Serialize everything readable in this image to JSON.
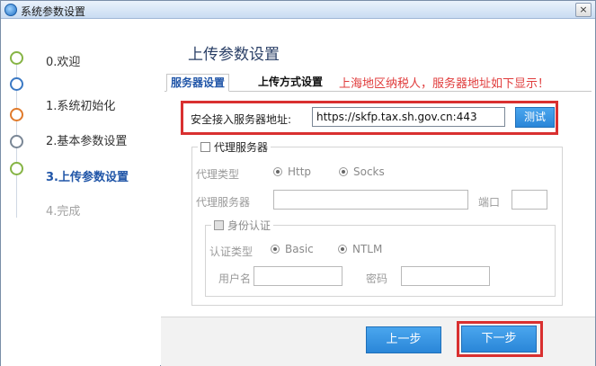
{
  "window": {
    "title": "系统参数设置",
    "close_glyph": "×"
  },
  "steps": [
    {
      "label": "0.欢迎",
      "state": "done"
    },
    {
      "label": "1.系统初始化",
      "state": "done"
    },
    {
      "label": "2.基本参数设置",
      "state": "done"
    },
    {
      "label": "3.上传参数设置",
      "state": "active"
    },
    {
      "label": "4.完成",
      "state": "disabled"
    }
  ],
  "panel": {
    "title": "上传参数设置"
  },
  "tabs": [
    {
      "label": "服务器设置",
      "active": true
    },
    {
      "label": "上传方式设置",
      "active": false
    }
  ],
  "annotation": "上海地区纳税人，服务器地址如下显示！",
  "server": {
    "label": "安全接入服务器地址:",
    "value": "https://skfp.tax.sh.gov.cn:443",
    "test_button": "测试"
  },
  "proxy": {
    "checkbox_label": "代理服务器",
    "checked": false,
    "type_label": "代理类型",
    "type_options": [
      {
        "label": "Http",
        "selected": true
      },
      {
        "label": "Socks",
        "selected": false
      }
    ],
    "server_label": "代理服务器",
    "server_value": "",
    "port_label": "端口",
    "port_value": ""
  },
  "auth": {
    "checkbox_label": "身份认证",
    "checked": false,
    "type_label": "认证类型",
    "type_options": [
      {
        "label": "Basic",
        "selected": true
      },
      {
        "label": "NTLM",
        "selected": false
      }
    ],
    "username_label": "用户名",
    "username_value": "",
    "password_label": "密码",
    "password_value": ""
  },
  "footer": {
    "prev_label": "上一步",
    "next_label": "下一步"
  },
  "colors": {
    "accent": "#2a86d8",
    "highlight": "#d93030",
    "annotation": "#e03c3c",
    "active_step": "#2156a8"
  }
}
